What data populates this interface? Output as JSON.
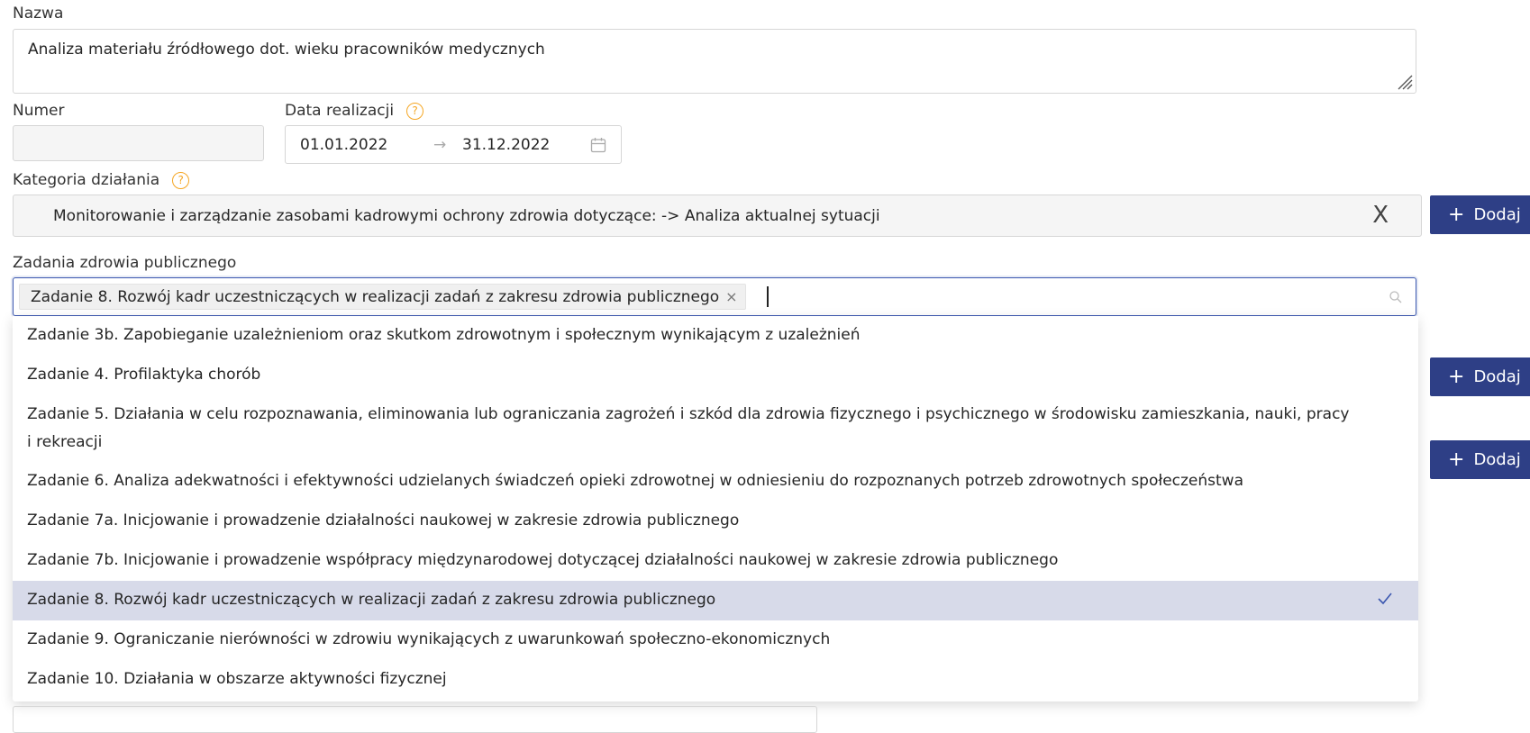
{
  "nazwa": {
    "label": "Nazwa",
    "value": "Analiza materiału źródłowego dot. wieku pracowników medycznych"
  },
  "numer": {
    "label": "Numer",
    "value": ""
  },
  "data_realizacji": {
    "label": "Data realizacji",
    "help_icon": "question-circle-icon",
    "start": "01.01.2022",
    "separator": "→",
    "end": "31.12.2022",
    "calendar_icon": "calendar-icon"
  },
  "kategoria": {
    "label": "Kategoria działania",
    "help_icon": "question-circle-icon",
    "value": "Monitorowanie i zarządzanie zasobami kadrowymi ochrony zdrowia dotyczące: -> Analiza aktualnej sytuacji",
    "clear": "X"
  },
  "add_buttons": [
    {
      "label": "Dodaj",
      "plus": "+"
    },
    {
      "label": "Dodaj",
      "plus": "+"
    },
    {
      "label": "Dodaj",
      "plus": "+"
    }
  ],
  "zadania": {
    "label": "Zadania zdrowia publicznego",
    "selected_tag": "Zadanie 8. Rozwój kadr uczestniczących w realizacji zadań z zakresu zdrowia publicznego",
    "tag_remove": "×",
    "search_icon": "search-icon"
  },
  "dropdown_options": [
    {
      "text": "Zadanie 3b. Zapobieganie uzależnieniom oraz skutkom zdrowotnym i społecznym wynikającym z uzależnień",
      "selected": false
    },
    {
      "text": "Zadanie 4. Profilaktyka chorób",
      "selected": false
    },
    {
      "text": "Zadanie 5. Działania w celu rozpoznawania, eliminowania lub ograniczania zagrożeń i szkód dla zdrowia fizycznego i psychicznego w środowisku zamieszkania, nauki, pracy",
      "text2": "i rekreacji",
      "selected": false
    },
    {
      "text": "Zadanie 6. Analiza adekwatności i efektywności udzielanych świadczeń opieki zdrowotnej w odniesieniu do rozpoznanych potrzeb zdrowotnych społeczeństwa",
      "selected": false
    },
    {
      "text": "Zadanie 7a. Inicjowanie i prowadzenie działalności naukowej w zakresie zdrowia publicznego",
      "selected": false
    },
    {
      "text": "Zadanie 7b. Inicjowanie i prowadzenie współpracy międzynarodowej dotyczącej działalności naukowej w zakresie zdrowia publicznego",
      "selected": false
    },
    {
      "text": "Zadanie 8. Rozwój kadr uczestniczących w realizacji zadań z zakresu zdrowia publicznego",
      "selected": true
    },
    {
      "text": "Zadanie 9. Ograniczanie nierówności w zdrowiu wynikających z uwarunkowań społeczno-ekonomicznych",
      "selected": false
    },
    {
      "text": "Zadanie 10. Działania w obszarze aktywności fizycznej",
      "selected": false
    }
  ],
  "colors": {
    "primary_button": "#2e3f86",
    "help_icon": "#f5a623",
    "focus_border": "#3b57b0",
    "selected_option": "#d7dae9"
  }
}
